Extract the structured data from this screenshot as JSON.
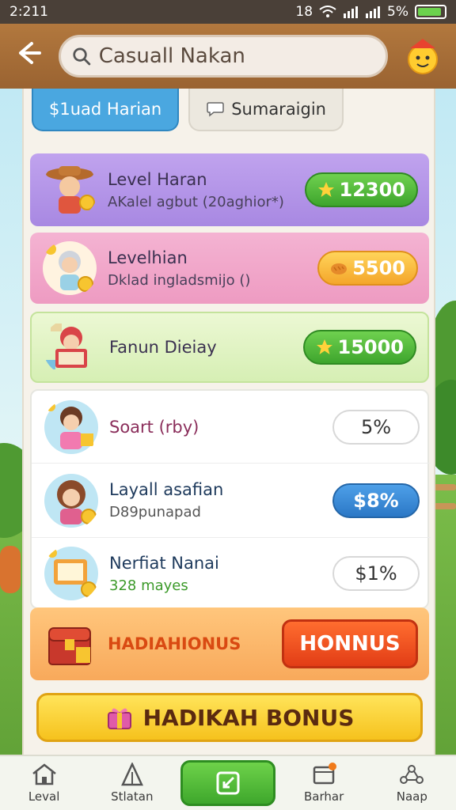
{
  "status_bar": {
    "time": "2:211",
    "signal_text": "18",
    "battery_text": "5%"
  },
  "header": {
    "search_value": "Casuall Nakan"
  },
  "tabs": [
    {
      "label": "$1uad Harian"
    },
    {
      "label": "Sumaraigin"
    }
  ],
  "cards": [
    {
      "title": "Level Haran",
      "subtitle": "AKalel agbut (20aghior*)",
      "value": "12300"
    },
    {
      "title": "Levelhian",
      "subtitle": "Dklad ingladsmijo ()",
      "value": "5500"
    },
    {
      "title": "Fanun Dieiay",
      "subtitle": "",
      "value": "15000"
    },
    {
      "title": "Soart (rby)",
      "subtitle": "",
      "value": "5%"
    },
    {
      "title": "Layall asafian",
      "subtitle": "D89punapad",
      "value": "$8%"
    },
    {
      "title": "Nerfiat Nanai",
      "subtitle": "328 mayes",
      "value": "$1%"
    }
  ],
  "bonus_row": {
    "label": "HADIAHIONUS",
    "button": "HONNUS"
  },
  "big_bonus": {
    "label": "HADIKAH BONUS"
  },
  "nav": [
    {
      "label": "Leval"
    },
    {
      "label": "Stlatan"
    },
    {
      "label": ""
    },
    {
      "label": "Barhar"
    },
    {
      "label": "Naap"
    }
  ],
  "colors": {
    "header": "#9a6331",
    "card_purple": "#b99be8",
    "card_pink": "#f2a8c9",
    "card_green": "#e2f5c3",
    "accent_blue": "#4aa7e0",
    "accent_green": "#3ea52d",
    "accent_orange": "#e23d16"
  }
}
